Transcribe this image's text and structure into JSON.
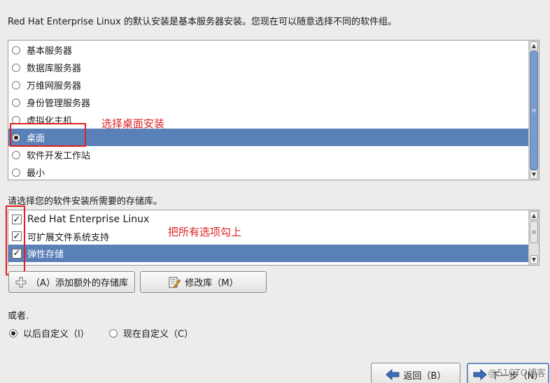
{
  "intro_text": "Red Hat Enterprise Linux 的默认安装是基本服务器安装。您现在可以随意选择不同的软件组。",
  "software_groups": [
    {
      "label": "基本服务器",
      "selected": false
    },
    {
      "label": "数据库服务器",
      "selected": false
    },
    {
      "label": "万维网服务器",
      "selected": false
    },
    {
      "label": "身份管理服务器",
      "selected": false
    },
    {
      "label": "虚拟化主机",
      "selected": false
    },
    {
      "label": "桌面",
      "selected": true
    },
    {
      "label": "软件开发工作站",
      "selected": false
    },
    {
      "label": "最小",
      "selected": false
    }
  ],
  "repo_prompt": "请选择您的软件安装所需要的存储库。",
  "repositories": [
    {
      "label": "Red Hat Enterprise Linux",
      "checked": true
    },
    {
      "label": "可扩展文件系统支持",
      "checked": true
    },
    {
      "label": "弹性存储",
      "checked": true
    }
  ],
  "buttons": {
    "add_repo": "（A）添加额外的存储库",
    "modify_repo": "修改库（M）",
    "back": "返回（B）",
    "next": "下一步（N）"
  },
  "or_label": "或者.",
  "customize_options": [
    {
      "label": "以后自定义（l）",
      "selected": true
    },
    {
      "label": "现在自定义（C）",
      "selected": false
    }
  ],
  "annotations": {
    "select_desktop": "选择桌面安装",
    "check_all": "把所有选项勾上"
  },
  "watermark": "@51CTO博客",
  "icons": {
    "scroll_up": "chevron-up-icon",
    "scroll_down": "chevron-down-icon",
    "add": "plus-icon",
    "edit": "edit-document-icon",
    "back": "arrow-left-icon",
    "next": "arrow-right-icon"
  },
  "colors": {
    "selection": "#5a80b8",
    "annotation": "#e02020",
    "background": "#edeceb"
  }
}
